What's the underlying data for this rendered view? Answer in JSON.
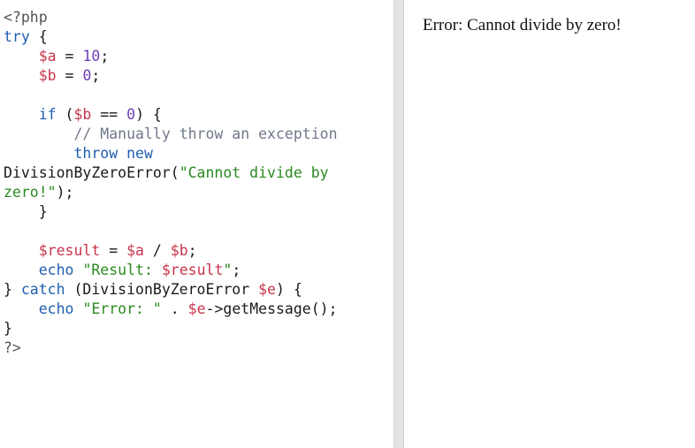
{
  "editor": {
    "lines": [
      [
        {
          "t": "<?php",
          "k": "tag"
        }
      ],
      [
        {
          "t": "try",
          "k": "kw"
        },
        {
          "t": " {",
          "k": "punct"
        }
      ],
      [
        {
          "t": "    ",
          "k": "plain"
        },
        {
          "t": "$a",
          "k": "var"
        },
        {
          "t": " = ",
          "k": "punct"
        },
        {
          "t": "10",
          "k": "num"
        },
        {
          "t": ";",
          "k": "punct"
        }
      ],
      [
        {
          "t": "    ",
          "k": "plain"
        },
        {
          "t": "$b",
          "k": "var"
        },
        {
          "t": " = ",
          "k": "punct"
        },
        {
          "t": "0",
          "k": "num"
        },
        {
          "t": ";",
          "k": "punct"
        }
      ],
      [
        {
          "t": "",
          "k": "plain"
        }
      ],
      [
        {
          "t": "    ",
          "k": "plain"
        },
        {
          "t": "if",
          "k": "kw"
        },
        {
          "t": " (",
          "k": "punct"
        },
        {
          "t": "$b",
          "k": "var"
        },
        {
          "t": " == ",
          "k": "punct"
        },
        {
          "t": "0",
          "k": "num"
        },
        {
          "t": ") {",
          "k": "punct"
        }
      ],
      [
        {
          "t": "        ",
          "k": "plain"
        },
        {
          "t": "// Manually throw an exception",
          "k": "cmt"
        }
      ],
      [
        {
          "t": "        ",
          "k": "plain"
        },
        {
          "t": "throw",
          "k": "kw"
        },
        {
          "t": " ",
          "k": "plain"
        },
        {
          "t": "new",
          "k": "kw"
        }
      ],
      [
        {
          "t": "DivisionByZeroError(",
          "k": "plain"
        },
        {
          "t": "\"Cannot divide by",
          "k": "str"
        }
      ],
      [
        {
          "t": "zero!\"",
          "k": "str"
        },
        {
          "t": ");",
          "k": "punct"
        }
      ],
      [
        {
          "t": "    }",
          "k": "punct"
        }
      ],
      [
        {
          "t": "",
          "k": "plain"
        }
      ],
      [
        {
          "t": "    ",
          "k": "plain"
        },
        {
          "t": "$result",
          "k": "var"
        },
        {
          "t": " = ",
          "k": "punct"
        },
        {
          "t": "$a",
          "k": "var"
        },
        {
          "t": " / ",
          "k": "punct"
        },
        {
          "t": "$b",
          "k": "var"
        },
        {
          "t": ";",
          "k": "punct"
        }
      ],
      [
        {
          "t": "    ",
          "k": "plain"
        },
        {
          "t": "echo",
          "k": "kw"
        },
        {
          "t": " ",
          "k": "plain"
        },
        {
          "t": "\"Result: ",
          "k": "str"
        },
        {
          "t": "$result",
          "k": "var"
        },
        {
          "t": "\"",
          "k": "str"
        },
        {
          "t": ";",
          "k": "punct"
        }
      ],
      [
        {
          "t": "} ",
          "k": "punct"
        },
        {
          "t": "catch",
          "k": "kw"
        },
        {
          "t": " (DivisionByZeroError ",
          "k": "plain"
        },
        {
          "t": "$e",
          "k": "var"
        },
        {
          "t": ") {",
          "k": "punct"
        }
      ],
      [
        {
          "t": "    ",
          "k": "plain"
        },
        {
          "t": "echo",
          "k": "kw"
        },
        {
          "t": " ",
          "k": "plain"
        },
        {
          "t": "\"Error: \"",
          "k": "str"
        },
        {
          "t": " . ",
          "k": "punct"
        },
        {
          "t": "$e",
          "k": "var"
        },
        {
          "t": "->getMessage();",
          "k": "plain"
        }
      ],
      [
        {
          "t": "}",
          "k": "punct"
        }
      ],
      [
        {
          "t": "?>",
          "k": "tag"
        }
      ]
    ]
  },
  "output": {
    "text": "Error: Cannot divide by zero!"
  },
  "colors": {
    "keyword": "#1f5fb0",
    "variable": "#c8354b",
    "number": "#6f3fb6",
    "string": "#2a8a1f",
    "comment": "#70788a",
    "divider": "#e4e4e4"
  }
}
